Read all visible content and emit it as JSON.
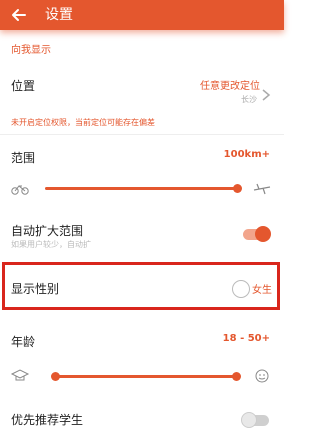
{
  "header": {
    "title": "设置",
    "back_icon": "arrow-left-icon",
    "background": "#e4572e"
  },
  "section_title": "向我显示",
  "location": {
    "label": "位置",
    "value": "任意更改定位",
    "sub_value": "长沙",
    "warning": "未开启定位权限，当前定位可能存在偏差"
  },
  "range": {
    "label": "范围",
    "value": "100km+",
    "slider_fraction": 0.985,
    "left_icon": "bicycle-icon",
    "right_icon": "airplane-icon"
  },
  "auto_expand": {
    "label": "自动扩大范围",
    "hint": "如果用户较少，自动扩",
    "enabled": true
  },
  "show_gender": {
    "label": "显示性别",
    "value": "女生",
    "selected": false
  },
  "age": {
    "label": "年龄",
    "value": "18 - 50+",
    "range_fraction": [
      0.0,
      1.0
    ],
    "left_icon": "graduation-cap-icon",
    "right_icon": "elderly-face-icon"
  },
  "priority_students": {
    "label": "优先推荐学生",
    "enabled": false
  },
  "colors": {
    "accent": "#e4572e",
    "highlight_border": "#d9261c"
  }
}
